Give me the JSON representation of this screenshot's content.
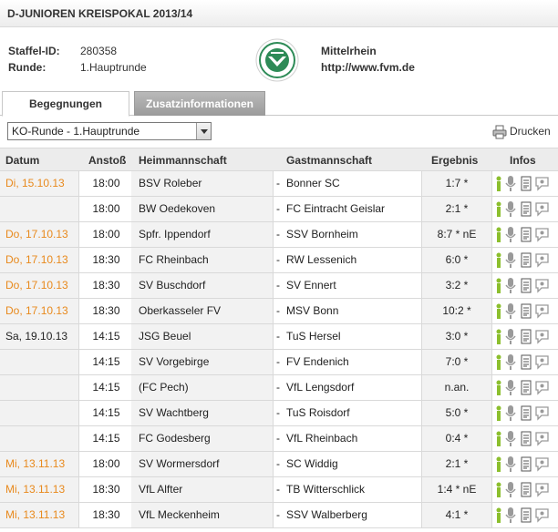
{
  "title": "D-JUNIOREN KREISPOKAL 2013/14",
  "info": {
    "staffel_label": "Staffel-ID:",
    "staffel_value": "280358",
    "runde_label": "Runde:",
    "runde_value": "1.Hauptrunde",
    "org_name": "Mittelrhein",
    "org_url": "http://www.fvm.de"
  },
  "tabs": [
    {
      "label": "Begegnungen",
      "active": true
    },
    {
      "label": "Zusatzinformationen",
      "active": false
    }
  ],
  "round_select": {
    "selected": "KO-Runde - 1.Hauptrunde"
  },
  "print_label": "Drucken",
  "columns": [
    "Datum",
    "Anstoß",
    "Heimmannschaft",
    "Gastmannschaft",
    "Ergebnis",
    "Infos"
  ],
  "colors": {
    "date_orange": "#e8891c",
    "icon_green": "#8cbf2e",
    "icon_grey": "#9a9a9a"
  },
  "icon_names": [
    "player-icon",
    "microphone-icon",
    "report-icon",
    "comment-icon"
  ],
  "matches": [
    {
      "date": "Di, 15.10.13",
      "date_orange": true,
      "time": "18:00",
      "home": "BSV Roleber",
      "dash": "-",
      "guest": "Bonner SC",
      "result": "1:7 *"
    },
    {
      "date": "",
      "date_orange": false,
      "time": "18:00",
      "home": "BW Oedekoven",
      "dash": "-",
      "guest": "FC Eintracht Geislar",
      "result": "2:1 *"
    },
    {
      "date": "Do, 17.10.13",
      "date_orange": true,
      "time": "18:00",
      "home": "Spfr. Ippendorf",
      "dash": "-",
      "guest": "SSV Bornheim",
      "result": "8:7 * nE"
    },
    {
      "date": "Do, 17.10.13",
      "date_orange": true,
      "time": "18:30",
      "home": "FC Rheinbach",
      "dash": "-",
      "guest": "RW Lessenich",
      "result": "6:0 *"
    },
    {
      "date": "Do, 17.10.13",
      "date_orange": true,
      "time": "18:30",
      "home": "SV Buschdorf",
      "dash": "-",
      "guest": "SV Ennert",
      "result": "3:2 *"
    },
    {
      "date": "Do, 17.10.13",
      "date_orange": true,
      "time": "18:30",
      "home": "Oberkasseler FV",
      "dash": "-",
      "guest": "MSV Bonn",
      "result": "10:2 *"
    },
    {
      "date": "Sa, 19.10.13",
      "date_orange": false,
      "time": "14:15",
      "home": "JSG Beuel",
      "dash": "-",
      "guest": "TuS Hersel",
      "result": "3:0 *"
    },
    {
      "date": "",
      "date_orange": false,
      "time": "14:15",
      "home": "SV Vorgebirge",
      "dash": "-",
      "guest": "FV Endenich",
      "result": "7:0 *"
    },
    {
      "date": "",
      "date_orange": false,
      "time": "14:15",
      "home": "(FC Pech)",
      "dash": "-",
      "guest": "VfL Lengsdorf",
      "result": "n.an."
    },
    {
      "date": "",
      "date_orange": false,
      "time": "14:15",
      "home": "SV Wachtberg",
      "dash": "-",
      "guest": "TuS Roisdorf",
      "result": "5:0 *"
    },
    {
      "date": "",
      "date_orange": false,
      "time": "14:15",
      "home": "FC Godesberg",
      "dash": "-",
      "guest": "VfL Rheinbach",
      "result": "0:4 *"
    },
    {
      "date": "Mi, 13.11.13",
      "date_orange": true,
      "time": "18:00",
      "home": "SV Wormersdorf",
      "dash": "-",
      "guest": "SC Widdig",
      "result": "2:1 *"
    },
    {
      "date": "Mi, 13.11.13",
      "date_orange": true,
      "time": "18:30",
      "home": "VfL Alfter",
      "dash": "-",
      "guest": "TB Witterschlick",
      "result": "1:4 * nE"
    },
    {
      "date": "Mi, 13.11.13",
      "date_orange": true,
      "time": "18:30",
      "home": "VfL Meckenheim",
      "dash": "-",
      "guest": "SSV Walberberg",
      "result": "4:1 *"
    }
  ]
}
